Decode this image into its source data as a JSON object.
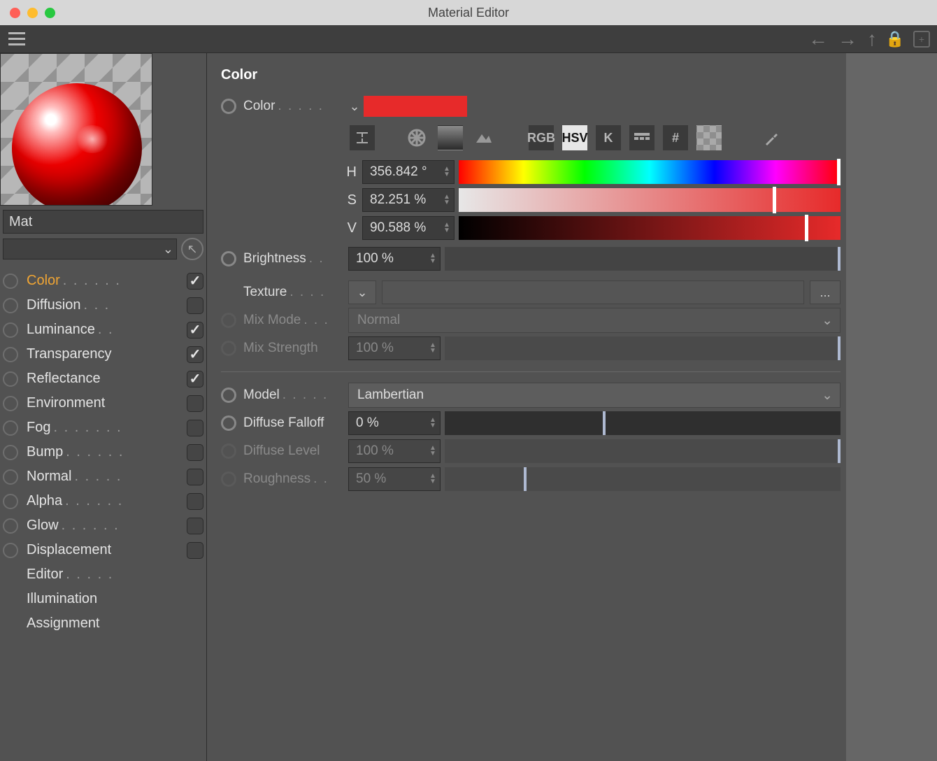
{
  "window": {
    "title": "Material Editor"
  },
  "material": {
    "name": "Mat"
  },
  "channels": [
    {
      "label": "Color",
      "dots": ". . . . . .",
      "checked": true,
      "hasCheckbox": true,
      "selected": true
    },
    {
      "label": "Diffusion",
      "dots": ". . .",
      "checked": false,
      "hasCheckbox": true
    },
    {
      "label": "Luminance",
      "dots": ". .",
      "checked": true,
      "hasCheckbox": true
    },
    {
      "label": "Transparency",
      "dots": "",
      "checked": true,
      "hasCheckbox": true
    },
    {
      "label": "Reflectance",
      "dots": "",
      "checked": true,
      "hasCheckbox": true
    },
    {
      "label": "Environment",
      "dots": "",
      "checked": false,
      "hasCheckbox": true
    },
    {
      "label": "Fog",
      "dots": ". . . . . . .",
      "checked": false,
      "hasCheckbox": true
    },
    {
      "label": "Bump",
      "dots": ". . . . . .",
      "checked": false,
      "hasCheckbox": true
    },
    {
      "label": "Normal",
      "dots": ". . . . .",
      "checked": false,
      "hasCheckbox": true
    },
    {
      "label": "Alpha",
      "dots": ". . . . . .",
      "checked": false,
      "hasCheckbox": true
    },
    {
      "label": "Glow",
      "dots": ". . . . . .",
      "checked": false,
      "hasCheckbox": true
    },
    {
      "label": "Displacement",
      "dots": "",
      "checked": false,
      "hasCheckbox": true
    },
    {
      "label": "Editor",
      "dots": ". . . . .",
      "hasCheckbox": false
    },
    {
      "label": "Illumination",
      "dots": "",
      "hasCheckbox": false
    },
    {
      "label": "Assignment",
      "dots": "",
      "hasCheckbox": false
    }
  ],
  "color_section": {
    "title": "Color",
    "color_label": "Color",
    "swatch_hex": "#E72A2A",
    "mode_buttons": [
      "RGB",
      "HSV",
      "K",
      "#"
    ],
    "mode_selected": "HSV",
    "hsv": {
      "h_label": "H",
      "s_label": "S",
      "v_label": "V",
      "h": "356.842 °",
      "s": "82.251 %",
      "v": "90.588 %",
      "h_pos_pct": 99.1,
      "s_pos_pct": 82.2,
      "v_pos_pct": 90.6
    },
    "brightness_label": "Brightness",
    "brightness": "100 %",
    "brightness_pos_pct": 100,
    "texture_label": "Texture",
    "browse_label": "...",
    "mixmode_label": "Mix Mode",
    "mixmode": "Normal",
    "mixstrength_label": "Mix Strength",
    "mixstrength": "100 %",
    "mixstrength_pos_pct": 100,
    "model_label": "Model",
    "model": "Lambertian",
    "falloff_label": "Diffuse Falloff",
    "falloff": "0 %",
    "falloff_pos_pct": 40,
    "diffuse_level_label": "Diffuse Level",
    "diffuse_level": "100 %",
    "diffuse_level_pos_pct": 100,
    "roughness_label": "Roughness",
    "roughness": "50 %",
    "roughness_pos_pct": 20
  }
}
